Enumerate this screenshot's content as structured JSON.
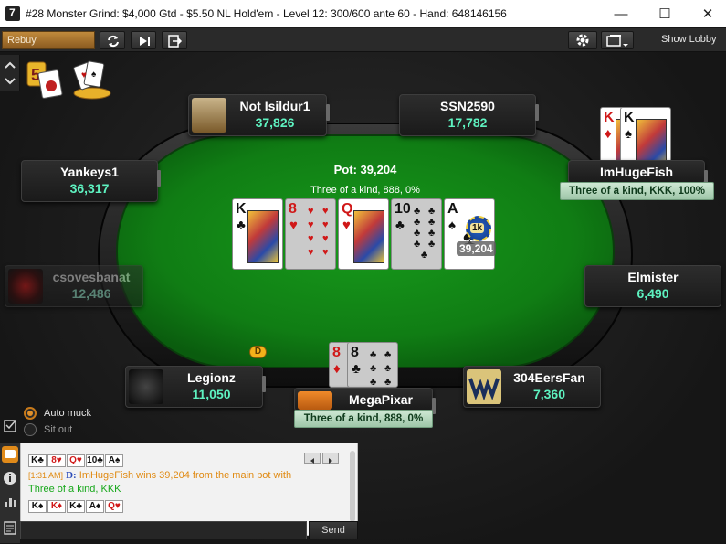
{
  "window": {
    "title": "#28 Monster Grind: $4,000 Gtd - $5.50 NL Hold'em - Level 12: 300/600 ante 60 - Hand: 648146156",
    "min_glyph": "—",
    "max_glyph": "☐",
    "close_glyph": "✕"
  },
  "toolbar": {
    "rebuy_label": "Rebuy",
    "show_lobby_label": "Show Lobby"
  },
  "pot": {
    "label": "Pot: 39,204",
    "hand_desc": "Three of a kind, 888, 0%",
    "chip_amount": "39,204",
    "chip_badge": "1k"
  },
  "board": [
    {
      "rank": "K",
      "suit": "♣",
      "color": "black",
      "dim": false
    },
    {
      "rank": "8",
      "suit": "♥",
      "color": "red",
      "dim": true
    },
    {
      "rank": "Q",
      "suit": "♥",
      "color": "red",
      "dim": false
    },
    {
      "rank": "10",
      "suit": "♣",
      "color": "black",
      "dim": true
    },
    {
      "rank": "A",
      "suit": "♠",
      "color": "black",
      "dim": false
    }
  ],
  "seats": [
    {
      "name": "Not Isildur1",
      "stack": "37,826"
    },
    {
      "name": "SSN2590",
      "stack": "17,782"
    },
    {
      "name": "Yankeys1",
      "stack": "36,317"
    },
    {
      "name": "ImHugeFish",
      "stack": "",
      "hand_label": "Three of a kind, KKK, 100%"
    },
    {
      "name": "csovesbanat",
      "stack": "12,486"
    },
    {
      "name": "Elmister",
      "stack": "6,490"
    },
    {
      "name": "Legionz",
      "stack": "11,050"
    },
    {
      "name": "304EersFan",
      "stack": "7,360"
    },
    {
      "name": "MegaPixar",
      "stack": "",
      "hand_label": "Three of a kind, 888, 0%"
    }
  ],
  "hole_cards": {
    "imhugefish": [
      {
        "rank": "K",
        "suit": "♦",
        "color": "red"
      },
      {
        "rank": "K",
        "suit": "♠",
        "color": "black"
      }
    ],
    "megapixar": [
      {
        "rank": "8",
        "suit": "♦",
        "color": "red"
      },
      {
        "rank": "8",
        "suit": "♣",
        "color": "black"
      }
    ]
  },
  "dealer_button": "D",
  "options": {
    "auto_muck": "Auto muck",
    "sit_out": "Sit out"
  },
  "chat": {
    "board_line": [
      "K♣",
      "8♥",
      "Q♥",
      "10♣",
      "A♠"
    ],
    "time": "[1:31 AM]",
    "dealer_tag": "D:",
    "winner": "ImHugeFish",
    "message": "wins 39,204 from the main pot with",
    "hand": "Three of a kind, KKK",
    "hand_cards": [
      "K♠",
      "K♦",
      "K♣",
      "A♠",
      "Q♥"
    ],
    "send_label": "Send",
    "input_value": ""
  },
  "colors": {
    "felt": "#137a16",
    "stack_green": "#5ef2c0",
    "chat_green": "#18a81c",
    "chat_orange": "#e08a12"
  }
}
